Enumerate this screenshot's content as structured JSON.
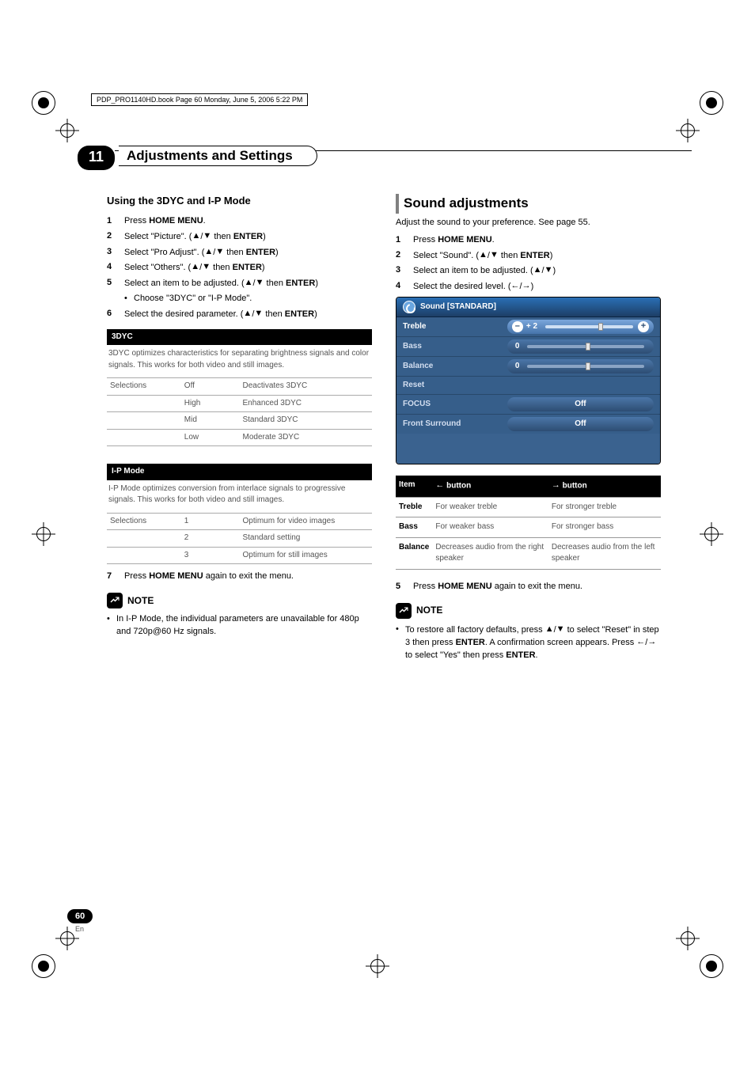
{
  "meta": {
    "bookline": "PDP_PRO1140HD.book  Page 60  Monday, June 5, 2006  5:22 PM"
  },
  "header": {
    "chapter": "11",
    "title": "Adjustments and Settings"
  },
  "left": {
    "h3": "Using the 3DYC and I-P Mode",
    "steps": [
      {
        "n": "1",
        "pre": "Press ",
        "b": "HOME MENU",
        "post": "."
      },
      {
        "n": "2",
        "pre": "Select \"Picture\". (",
        "arr": "updown",
        "post1": " then ",
        "b": "ENTER",
        "post2": ")"
      },
      {
        "n": "3",
        "pre": "Select \"Pro Adjust\". (",
        "arr": "updown",
        "post1": " then ",
        "b": "ENTER",
        "post2": ")"
      },
      {
        "n": "4",
        "pre": "Select \"Others\". (",
        "arr": "updown",
        "post1": " then ",
        "b": "ENTER",
        "post2": ")"
      },
      {
        "n": "5",
        "pre": "Select an item to be adjusted. (",
        "arr": "updown",
        "post1": " then ",
        "b": "ENTER",
        "post2": ")",
        "bullet": "Choose \"3DYC\" or \"I-P Mode\"."
      },
      {
        "n": "6",
        "pre": "Select the desired parameter. (",
        "arr": "updown",
        "post1": " then ",
        "b": "ENTER",
        "post2": ")"
      }
    ],
    "box1": {
      "title": "3DYC",
      "desc": "3DYC optimizes characteristics for separating brightness signals and color signals. This works for both video and still images.",
      "sel": "Selections",
      "rows": [
        {
          "a": "Off",
          "b": "Deactivates 3DYC"
        },
        {
          "a": "High",
          "b": "Enhanced 3DYC"
        },
        {
          "a": "Mid",
          "b": "Standard 3DYC"
        },
        {
          "a": "Low",
          "b": "Moderate 3DYC"
        }
      ]
    },
    "box2": {
      "title": "I-P Mode",
      "desc": "I-P Mode optimizes conversion from interlace signals to progressive signals. This works for both video and still images.",
      "sel": "Selections",
      "rows": [
        {
          "a": "1",
          "b": "Optimum for video images"
        },
        {
          "a": "2",
          "b": "Standard setting"
        },
        {
          "a": "3",
          "b": "Optimum for still images"
        }
      ]
    },
    "step7": {
      "n": "7",
      "pre": "Press ",
      "b": "HOME MENU",
      "post": " again to exit the menu."
    },
    "note_lbl": "NOTE",
    "note1": "In I-P Mode, the individual parameters are unavailable for 480p and 720p@60 Hz signals."
  },
  "right": {
    "h2": "Sound adjustments",
    "intro": "Adjust the sound to your preference. See page 55.",
    "steps": [
      {
        "n": "1",
        "pre": "Press ",
        "b": "HOME MENU",
        "post": "."
      },
      {
        "n": "2",
        "pre": "Select \"Sound\". (",
        "arr": "updown",
        "post1": " then ",
        "b": "ENTER",
        "post2": ")"
      },
      {
        "n": "3",
        "pre": "Select an item to be adjusted. (",
        "arr": "updown",
        "post2": ")"
      },
      {
        "n": "4",
        "pre": "Select the desired level. (",
        "arr": "leftright",
        "post2": ")"
      }
    ],
    "osd": {
      "title": "Sound [STANDARD]",
      "rows": [
        {
          "label": "Treble",
          "type": "slider",
          "val": "+   2",
          "thumb": 60,
          "minus": "–",
          "plus": "+",
          "hl": true
        },
        {
          "label": "Bass",
          "type": "slider",
          "val": "0",
          "thumb": 50,
          "minus": "",
          "plus": ""
        },
        {
          "label": "Balance",
          "type": "slider",
          "val": "0",
          "thumb": 50,
          "minus": "",
          "plus": ""
        },
        {
          "label": "Reset",
          "type": "none"
        },
        {
          "label": "FOCUS",
          "type": "off",
          "text": "Off"
        },
        {
          "label": "Front Surround",
          "type": "off",
          "text": "Off"
        }
      ]
    },
    "btntable": {
      "head": {
        "item": "Item",
        "left": " button",
        "right": " button",
        "larrow": "←",
        "rarrow": "→"
      },
      "rows": [
        {
          "item": "Treble",
          "l": "For weaker treble",
          "r": "For stronger treble"
        },
        {
          "item": "Bass",
          "l": "For weaker bass",
          "r": "For stronger bass"
        },
        {
          "item": "Balance",
          "l": "Decreases audio from the right speaker",
          "r": "Decreases audio from the left speaker"
        }
      ]
    },
    "step5": {
      "n": "5",
      "pre": "Press ",
      "b": "HOME MENU",
      "post": " again to exit the menu."
    },
    "note_lbl": "NOTE",
    "note1a": "To restore all factory defaults, press ",
    "note1b": " to select \"Reset\" in step 3 then press ",
    "note1c": ". A confirmation screen appears. Press ",
    "note1d": " to select \"Yes\" then press ",
    "note1e": ".",
    "enter": "ENTER"
  },
  "footer": {
    "page": "60",
    "lang": "En"
  }
}
